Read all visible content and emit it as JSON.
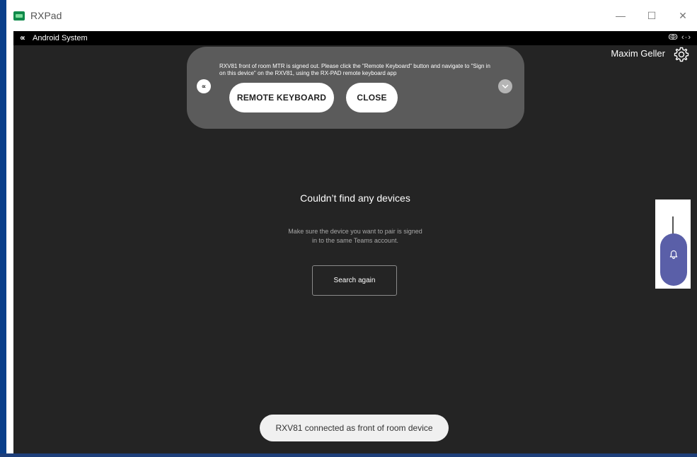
{
  "window": {
    "title": "RXPad",
    "minimize_glyph": "—",
    "maximize_glyph": "☐",
    "close_glyph": "✕"
  },
  "statusbar": {
    "logo": "∝",
    "label": "Android System",
    "right_icons": "ↂ ‹·›"
  },
  "header": {
    "user_name": "Maxim Geller",
    "settings_icon": "gear-icon"
  },
  "notification": {
    "icon_glyph": "∝",
    "message": "RXV81 front of room MTR is signed out. Please click the \"Remote Keyboard\" button and navigate to \"Sign in on this device\" on the RXV81, using the RX-PAD remote keyboard app",
    "remote_keyboard_label": "REMOTE KEYBOARD",
    "close_label": "CLOSE"
  },
  "main": {
    "empty_title": "Couldn’t find any devices",
    "empty_desc_line1": "Make sure the device you want to pair is signed",
    "empty_desc_line2": "in to the same Teams account.",
    "search_again_label": "Search again"
  },
  "toast": {
    "text": "RXV81 connected as front of room device"
  },
  "side_panel": {
    "icon": "bell-icon",
    "accent_color": "#5a5fa8"
  }
}
